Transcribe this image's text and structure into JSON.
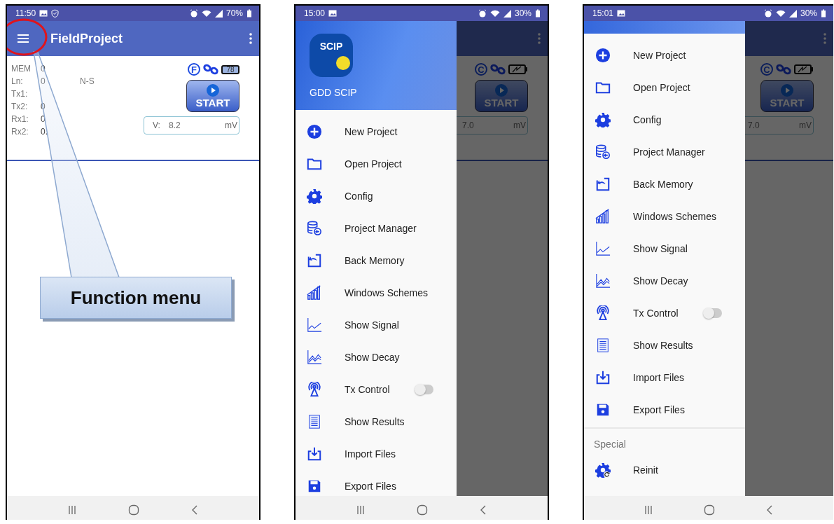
{
  "screens": [
    {
      "kind": "main",
      "status_bar": {
        "time": "11:50",
        "battery": "70%"
      },
      "app_bar": {
        "title": "FieldProject"
      },
      "readings": [
        {
          "label": "MEM",
          "value": "0"
        },
        {
          "label": "Ln:",
          "value": "0",
          "extra": "N-S"
        },
        {
          "label": "Tx1:"
        },
        {
          "label": "Tx2:",
          "value": "0"
        },
        {
          "label": "Rx1:",
          "value": "0"
        },
        {
          "label": "Rx2:",
          "value": "0."
        }
      ],
      "mode_letter": "F",
      "battery_level": "78",
      "start": "START",
      "field": {
        "label": "V:",
        "value": "8.2",
        "unit": "mV"
      },
      "annotation": {
        "text": "Function menu"
      }
    },
    {
      "kind": "drawer",
      "status_bar": {
        "time": "15:00",
        "battery": "30%"
      },
      "header": {
        "app_name": "GDD SCIP",
        "logo_text": "SCIP"
      },
      "mode_letter": "C",
      "start": "START",
      "field": {
        "value": "7.0",
        "unit": "mV"
      },
      "items": [
        {
          "kind": "action",
          "label": "New Project"
        },
        {
          "kind": "action",
          "label": "Open Project"
        },
        {
          "kind": "action",
          "label": "Config"
        },
        {
          "kind": "action",
          "label": "Project Manager"
        },
        {
          "kind": "action",
          "label": "Back Memory"
        },
        {
          "kind": "action",
          "label": "Windows Schemes"
        },
        {
          "kind": "action",
          "label": "Show Signal"
        },
        {
          "kind": "action",
          "label": "Show Decay"
        },
        {
          "kind": "toggle",
          "label": "Tx Control",
          "on": false
        },
        {
          "kind": "action",
          "label": "Show Results"
        },
        {
          "kind": "action",
          "label": "Import Files"
        },
        {
          "kind": "action",
          "label": "Export Files"
        }
      ]
    },
    {
      "kind": "drawer",
      "status_bar": {
        "time": "15:01",
        "battery": "30%"
      },
      "mode_letter": "C",
      "start": "START",
      "field": {
        "value": "7.0",
        "unit": "mV"
      },
      "items": [
        {
          "kind": "action",
          "label": "New Project"
        },
        {
          "kind": "action",
          "label": "Open Project"
        },
        {
          "kind": "action",
          "label": "Config"
        },
        {
          "kind": "action",
          "label": "Project Manager"
        },
        {
          "kind": "action",
          "label": "Back Memory"
        },
        {
          "kind": "action",
          "label": "Windows Schemes"
        },
        {
          "kind": "action",
          "label": "Show Signal"
        },
        {
          "kind": "action",
          "label": "Show Decay"
        },
        {
          "kind": "toggle",
          "label": "Tx Control",
          "on": false
        },
        {
          "kind": "action",
          "label": "Show Results"
        },
        {
          "kind": "action",
          "label": "Import Files"
        },
        {
          "kind": "action",
          "label": "Export Files"
        }
      ],
      "special": {
        "heading": "Special",
        "items": [
          {
            "label": "Reinit"
          }
        ]
      }
    }
  ]
}
